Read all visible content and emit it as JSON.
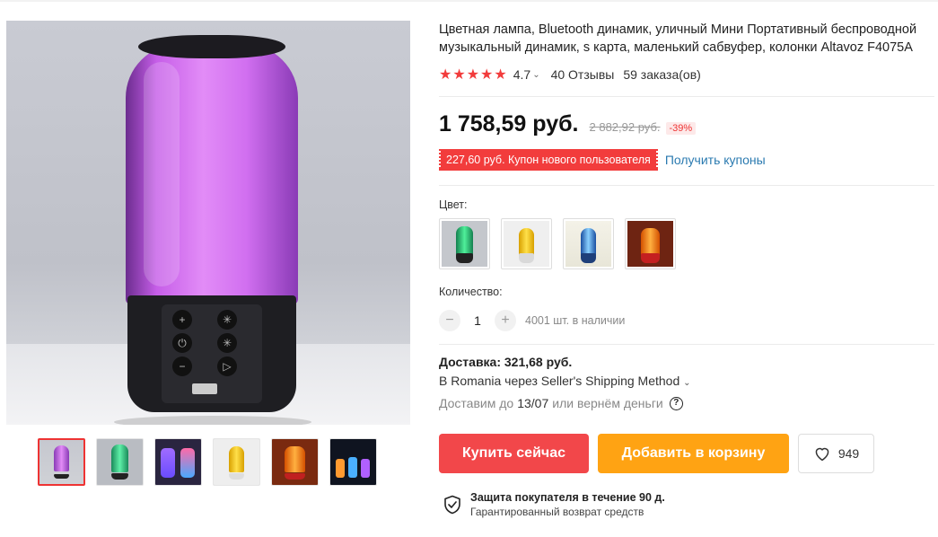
{
  "product": {
    "title": "Цветная лампа, Bluetooth динамик, уличный Мини Портативный беспроводной музыкальный динамик, s карта, маленький сабвуфер, колонки Altavoz F4075A",
    "stars": "★★★★★",
    "rating": "4.7",
    "reviews": "40 Отзывы",
    "orders": "59 заказа(ов)"
  },
  "price": {
    "current": "1 758,59 руб.",
    "old": "2 882,92 руб.",
    "discount": "-39%"
  },
  "coupon": {
    "text": "227,60 руб. Купон нового пользователя",
    "link": "Получить купоны"
  },
  "color": {
    "label": "Цвет:",
    "options": [
      "green",
      "yellow",
      "blue",
      "red"
    ]
  },
  "quantity": {
    "label": "Количество:",
    "value": "1",
    "minus": "−",
    "plus": "+",
    "stock": "4001 шт. в наличии"
  },
  "shipping": {
    "title": "Доставка: 321,68 руб.",
    "method": "В Romania через Seller's Shipping Method",
    "date_prefix": "Доставим до",
    "date": "13/07",
    "date_suffix": "или вернём деньги"
  },
  "actions": {
    "buy": "Купить сейчас",
    "cart": "Добавить в корзину",
    "wish_count": "949"
  },
  "protection": {
    "title": "Защита покупателя в течение 90 д.",
    "subtitle": "Гарантированный возврат средств"
  },
  "colors": {
    "accent": "#f2474a",
    "cart": "#ffa313",
    "star": "#f23c3c",
    "link": "#2a7ab0"
  }
}
